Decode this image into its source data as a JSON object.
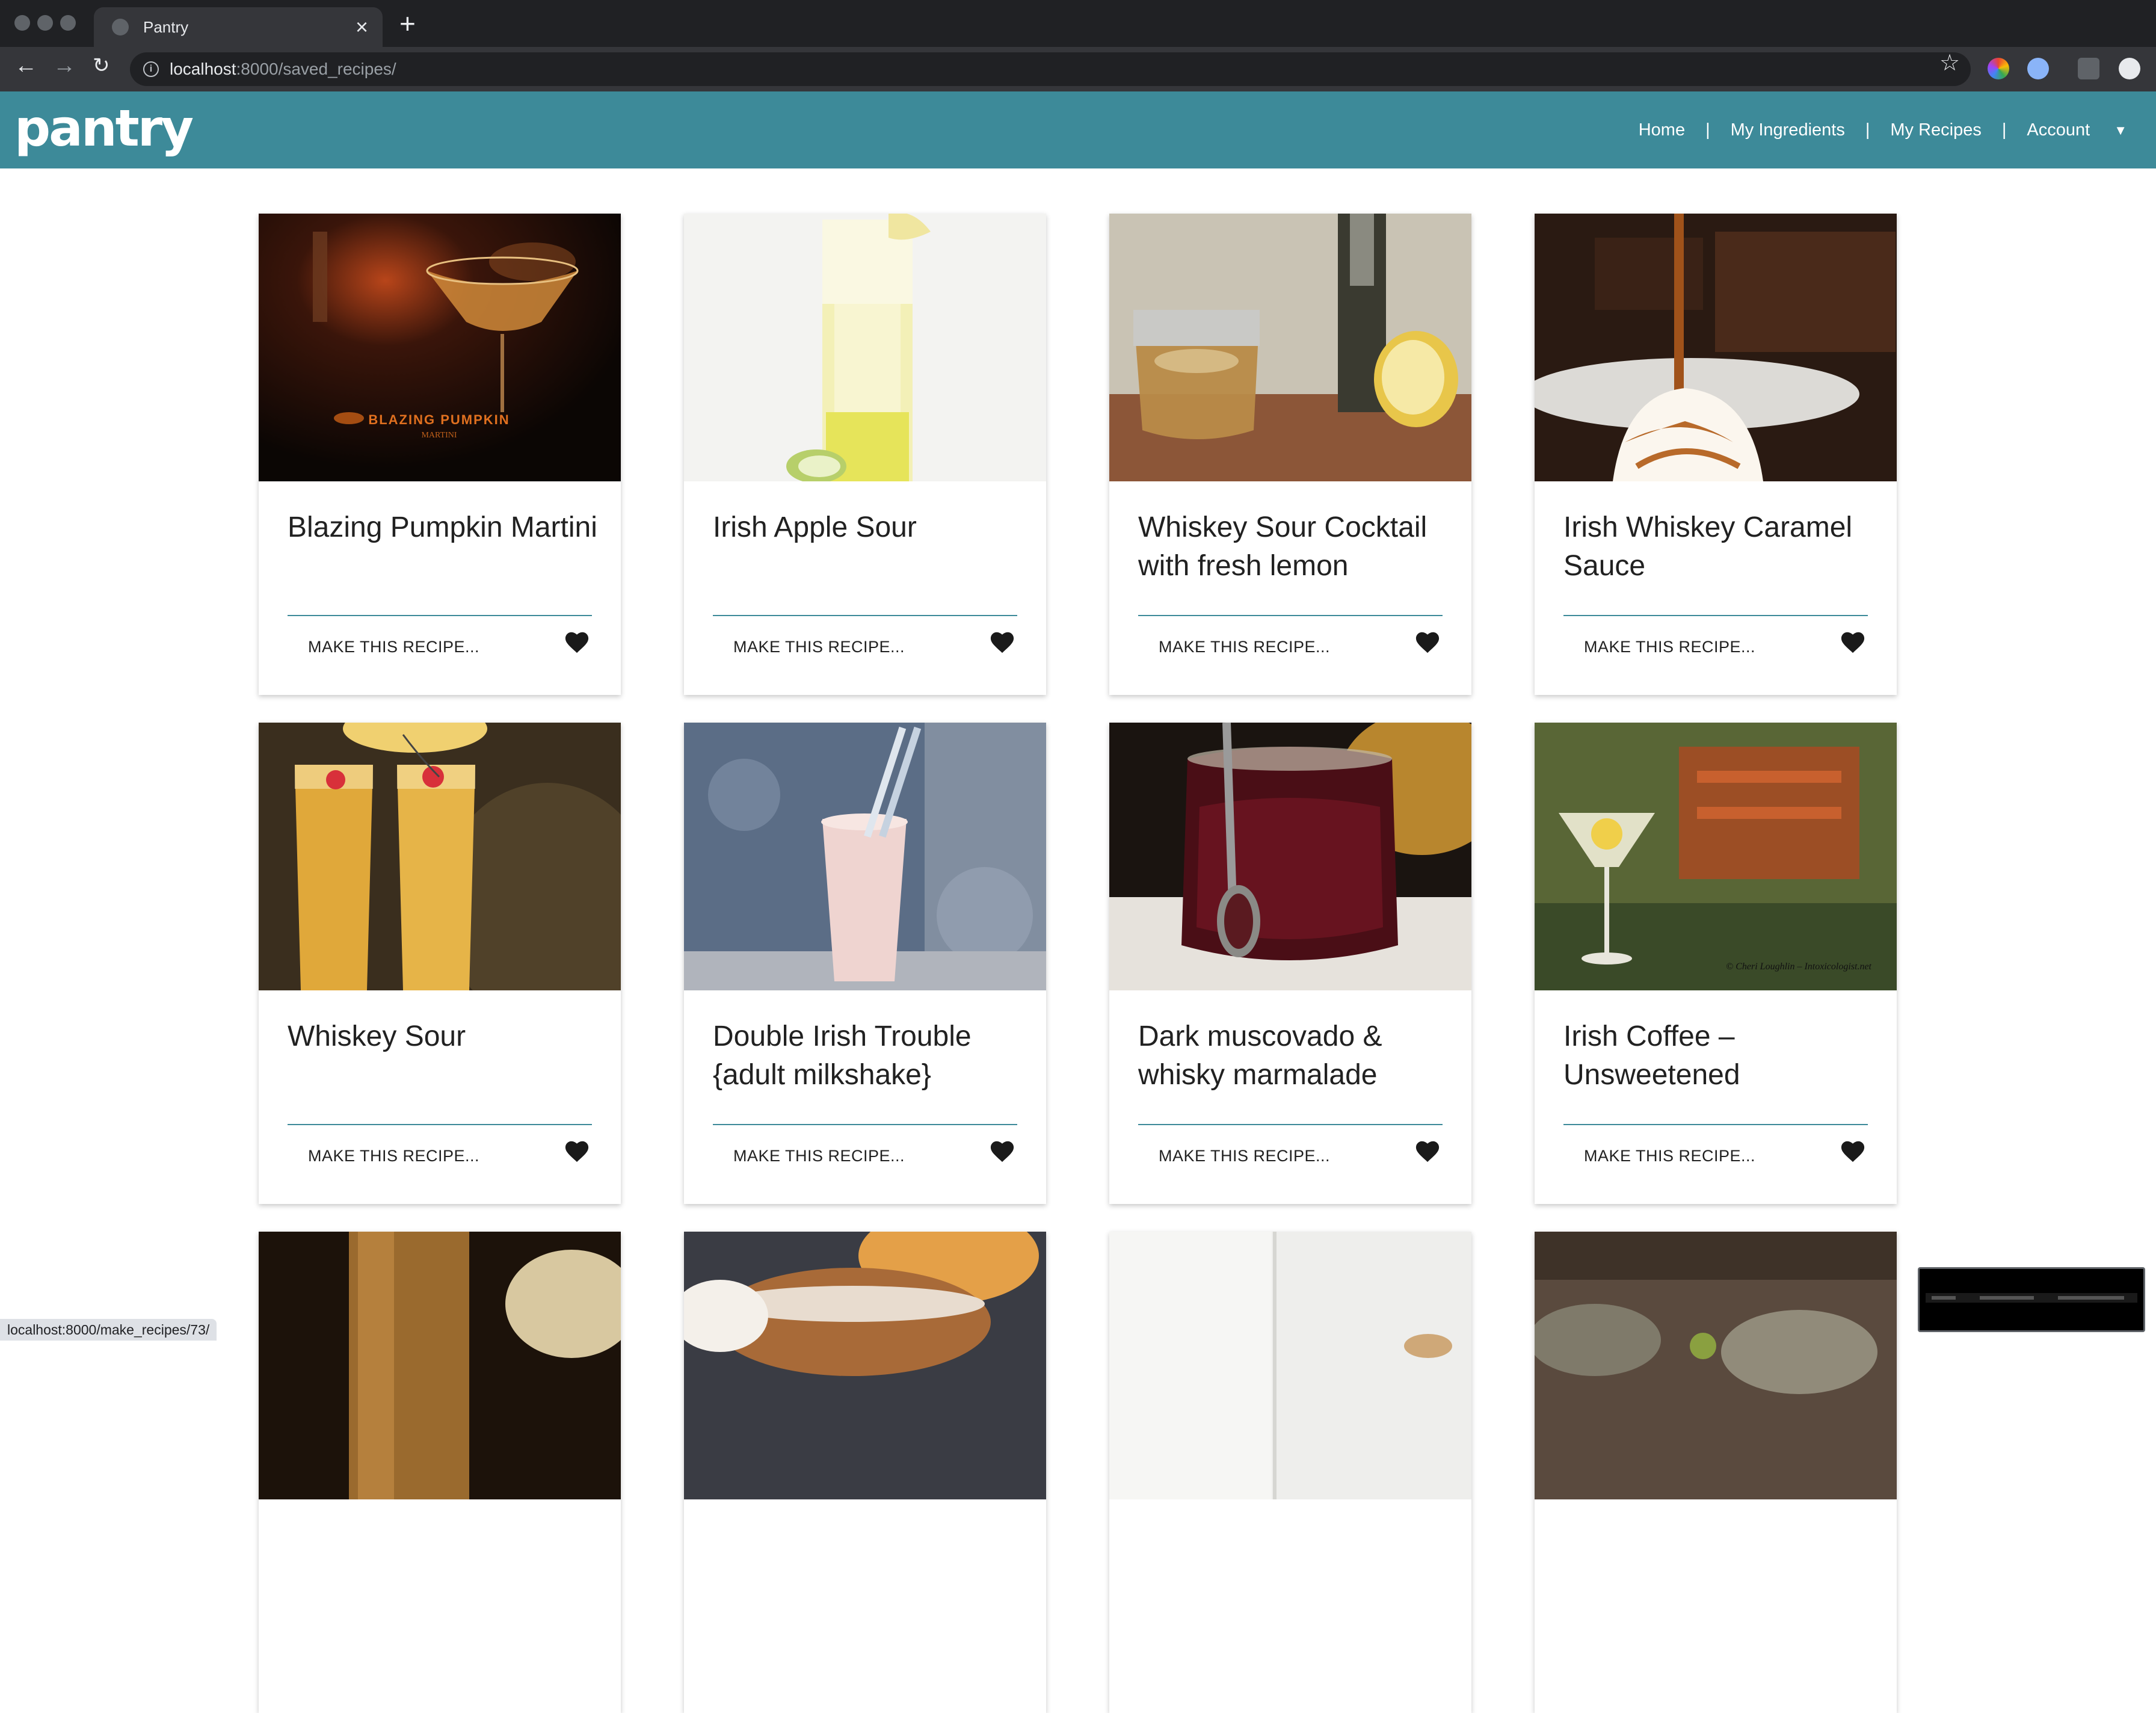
{
  "browser": {
    "tab_title": "Pantry",
    "url_host": "localhost",
    "url_path": ":8000/saved_recipes/",
    "status_url": "localhost:8000/make_recipes/73/"
  },
  "header": {
    "logo": "pantry",
    "nav": {
      "home": "Home",
      "ingredients": "My Ingredients",
      "recipes": "My Recipes",
      "account": "Account",
      "separator": "|"
    }
  },
  "action_label": "MAKE THIS RECIPE...",
  "recipes": [
    {
      "title": "Blazing Pumpkin Martini",
      "image_text": "BLAZING PUMPKIN",
      "image_subtext": "MARTINI"
    },
    {
      "title": "Irish Apple Sour"
    },
    {
      "title": "Whiskey Sour Cocktail with fresh lemon"
    },
    {
      "title": "Irish Whiskey Caramel Sauce"
    },
    {
      "title": "Whiskey Sour"
    },
    {
      "title": "Double Irish Trouble {adult milkshake}"
    },
    {
      "title": "Dark muscovado & whisky marmalade"
    },
    {
      "title": "Irish Coffee – Unsweetened",
      "image_text": "© Cheri Loughlin – Intoxicologist.net"
    },
    {
      "title": ""
    },
    {
      "title": ""
    },
    {
      "title": ""
    },
    {
      "title": ""
    }
  ],
  "colors": {
    "brand": "#3d8a99",
    "text": "#212121",
    "chrome_dark": "#202124",
    "chrome_toolbar": "#35363a"
  }
}
